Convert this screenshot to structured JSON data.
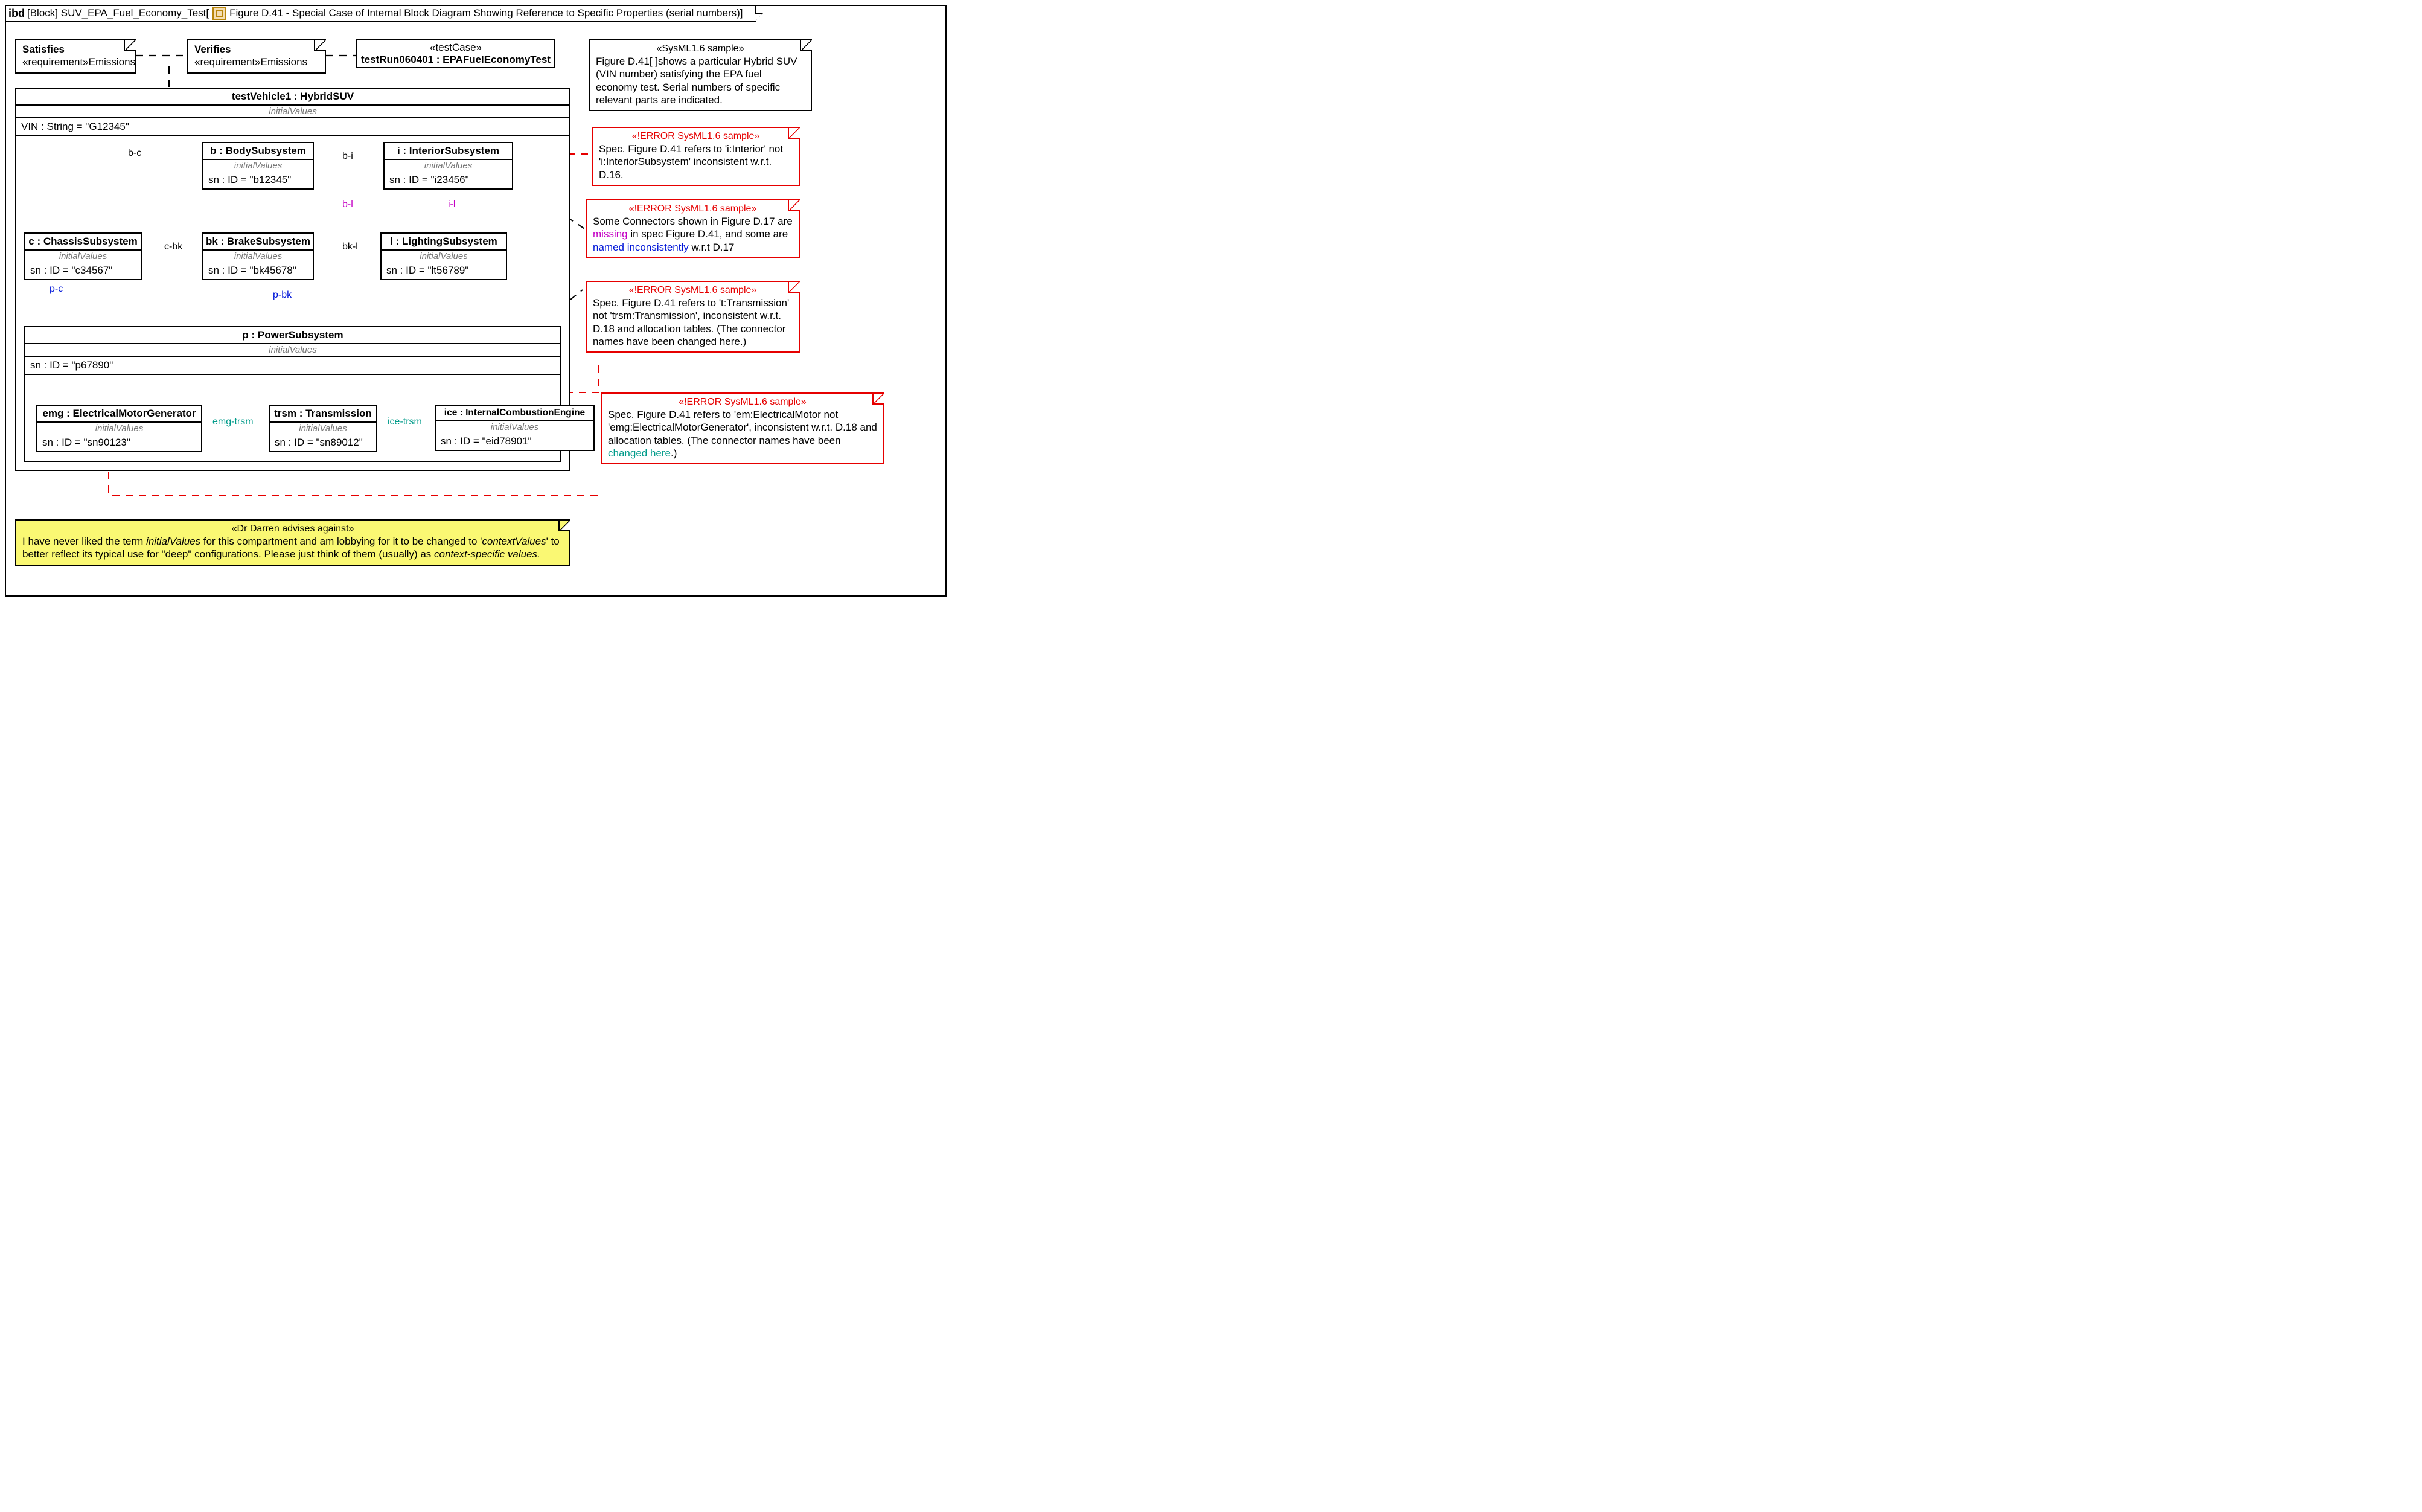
{
  "frame": {
    "kind": "ibd",
    "context": "[Block] SUV_EPA_Fuel_Economy_Test[",
    "caption": " Figure D.41 - Special Case of Internal Block Diagram Showing Reference to Specific Properties (serial numbers)]"
  },
  "notes": {
    "satisfies": {
      "title": "Satisfies",
      "body": "«requirement»Emissions"
    },
    "verifies": {
      "title": "Verifies",
      "body": "«requirement»Emissions"
    },
    "testCase": {
      "stereo": "«testCase»",
      "body": "testRun060401 : EPAFuelEconomyTest"
    },
    "sysml": {
      "stereo": "«SysML1.6 sample»",
      "body": "Figure D.41[ ]shows a particular Hybrid SUV (VIN number) satisfying the EPA fuel economy test. Serial numbers of specific relevant parts are indicated."
    },
    "err1": {
      "stereo": "«!ERROR SysML1.6 sample»",
      "body": "Spec. Figure D.41 refers to 'i:Interior' not 'i:InteriorSubsystem' inconsistent w.r.t. D.16."
    },
    "err2": {
      "stereo": "«!ERROR SysML1.6 sample»",
      "pre": "Some Connectors shown in Figure D.17 are ",
      "missing": "missing",
      "mid": " in spec Figure D.41, and some are ",
      "named": "named inconsistently",
      "post": " w.r.t D.17"
    },
    "err3": {
      "stereo": "«!ERROR SysML1.6 sample»",
      "body": "Spec. Figure D.41 refers to 't:Transmission' not 'trsm:Transmission', inconsistent w.r.t. D.18 and allocation tables. (The connector names have been changed here.)"
    },
    "err4": {
      "stereo": "«!ERROR SysML1.6 sample»",
      "pre": "Spec. Figure D.41 refers to 'em:ElectricalMotor not 'emg:ElectricalMotorGenerator', inconsistent w.r.t. D.18 and allocation tables. (The connector names have been ",
      "changed": "changed here",
      "post": ".)"
    },
    "advice": {
      "stereo": "«Dr Darren advises against»",
      "pre": "I have never liked the term ",
      "iv": "initialValues",
      "mid": " for this compartment and am lobbying for it to be changed to '",
      "cv_plain": "contextValues",
      "mid2": "' to better reflect its typical use for \"deep\" configurations. Please just think of them (usually) as ",
      "csv": "context-specific values."
    }
  },
  "blocks": {
    "vehicle": {
      "title": "testVehicle1 : HybridSUV",
      "compart": "initialValues",
      "vin": "VIN : String = \"G12345\""
    },
    "b": {
      "title": "b : BodySubsystem",
      "compart": "initialValues",
      "sn": "sn : ID = \"b12345\""
    },
    "i": {
      "title": "i : InteriorSubsystem",
      "compart": "initialValues",
      "sn": "sn : ID = \"i23456\""
    },
    "c": {
      "title": "c : ChassisSubsystem",
      "compart": "initialValues",
      "sn": "sn : ID = \"c34567\""
    },
    "bk": {
      "title": "bk : BrakeSubsystem",
      "compart": "initialValues",
      "sn": "sn : ID = \"bk45678\""
    },
    "l": {
      "title": "l : LightingSubsystem",
      "compart": "initialValues",
      "sn": "sn : ID = \"lt56789\""
    },
    "p": {
      "title": "p : PowerSubsystem",
      "compart": "initialValues",
      "sn": "sn : ID = \"p67890\""
    },
    "emg": {
      "title": "emg : ElectricalMotorGenerator",
      "compart": "initialValues",
      "sn": "sn : ID = \"sn90123\""
    },
    "trsm": {
      "title": "trsm : Transmission",
      "compart": "initialValues",
      "sn": "sn : ID = \"sn89012\""
    },
    "ice": {
      "title": "ice : InternalCombustionEngine",
      "compart": "initialValues",
      "sn": "sn : ID = \"eid78901\""
    }
  },
  "connectors": {
    "bc": "b-c",
    "bi": "b-i",
    "bl": "b-l",
    "il": "i-l",
    "cbk": "c-bk",
    "bkl": "bk-l",
    "pc": "p-c",
    "pbk": "p-bk",
    "emgtrsm": "emg-trsm",
    "icetrsm": "ice-trsm"
  }
}
